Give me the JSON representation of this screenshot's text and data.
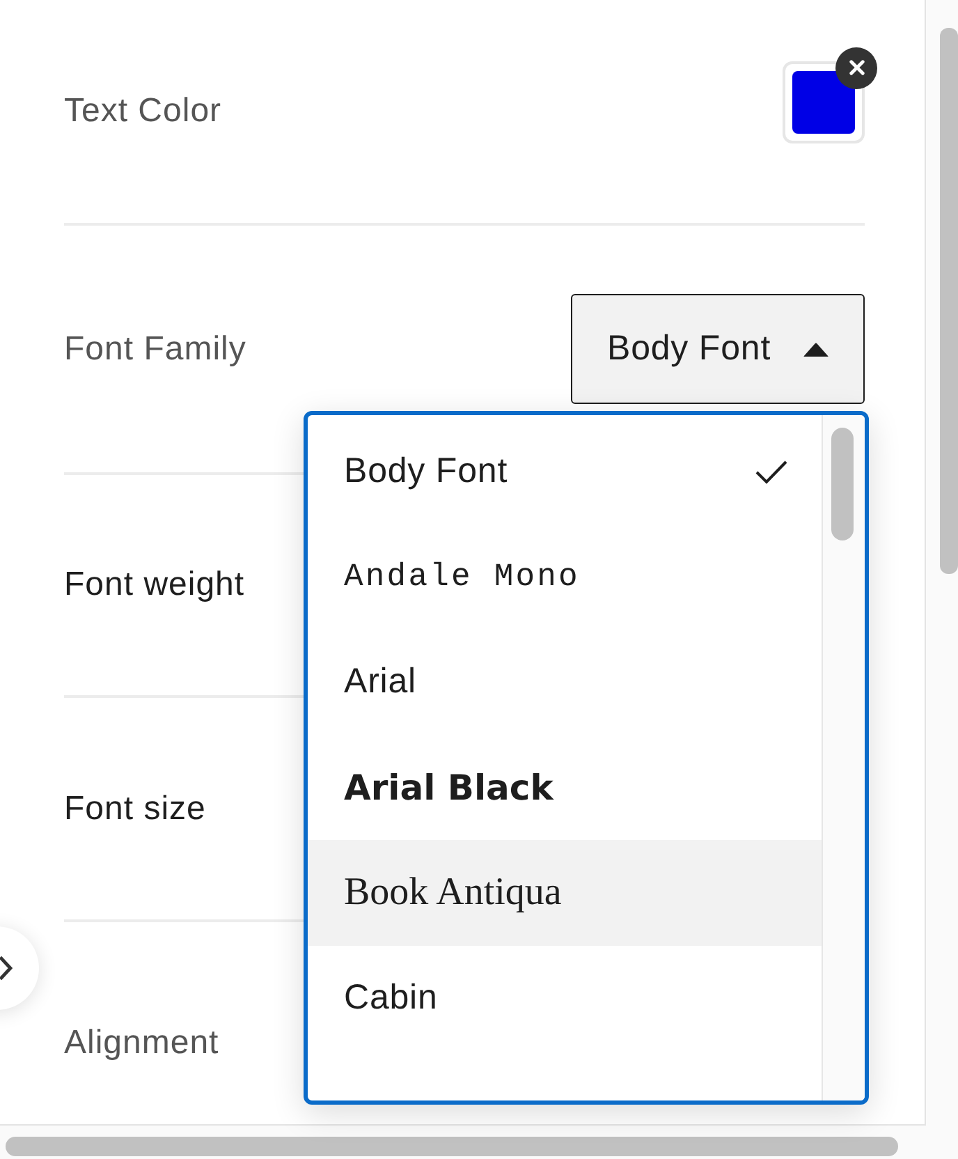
{
  "settings": [
    {
      "kind": "color",
      "label": "Text Color",
      "color": "#0000e6"
    },
    {
      "kind": "select",
      "label": "Font Family",
      "value": "Body Font",
      "expanded": true,
      "options": [
        {
          "label": "Body Font",
          "kind": "sans",
          "selected": true,
          "highlighted": false
        },
        {
          "label": "Andale Mono",
          "kind": "mono",
          "selected": false,
          "highlighted": false
        },
        {
          "label": "Arial",
          "kind": "sans",
          "selected": false,
          "highlighted": false
        },
        {
          "label": "Arial Black",
          "kind": "black",
          "selected": false,
          "highlighted": false
        },
        {
          "label": "Book Antiqua",
          "kind": "serif",
          "selected": false,
          "highlighted": true
        },
        {
          "label": "Cabin",
          "kind": "sans",
          "selected": false,
          "highlighted": false
        }
      ]
    },
    {
      "kind": "field",
      "label": "Font weight"
    },
    {
      "kind": "field",
      "label": "Font size"
    },
    {
      "kind": "setting",
      "label": "Alignment"
    }
  ]
}
